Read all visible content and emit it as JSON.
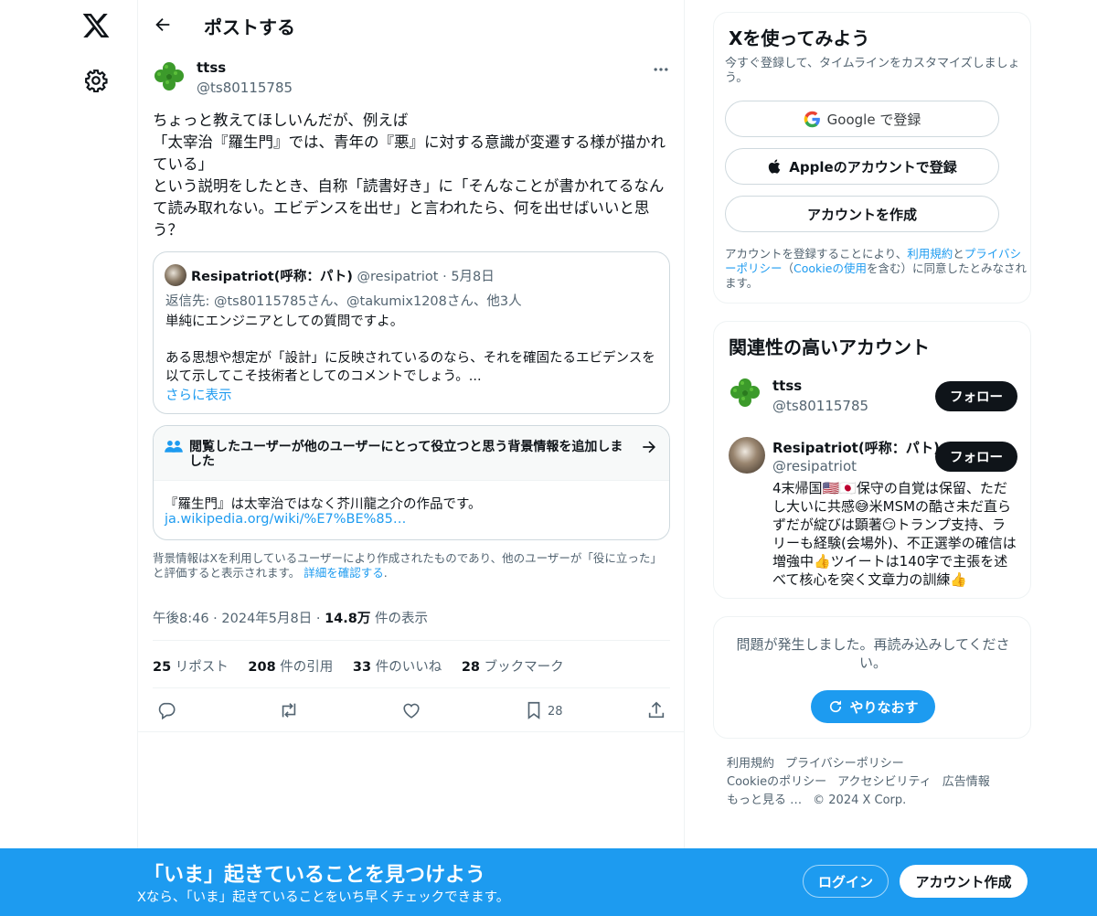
{
  "header": {
    "title": "ポストする"
  },
  "post": {
    "author_name": "ttss",
    "author_handle": "@ts80115785",
    "text": "ちょっと教えてほしいんだが、例えば\n「太宰治『羅生門』では、青年の『悪』に対する意識が変遷する様が描かれている」\nという説明をしたとき、自称「読書好き」に「そんなことが書かれてるなんて読み取れない。エビデンスを出せ」と言われたら、何を出せばいいと思う？",
    "time": "午後8:46",
    "date": "2024年5月8日",
    "views_count": "14.8万",
    "views_label": "件の表示",
    "reposts_count": "25",
    "reposts_label": "リポスト",
    "quotes_count": "208",
    "quotes_label": "件の引用",
    "likes_count": "33",
    "likes_label": "件のいいね",
    "bookmarks_count": "28",
    "bookmarks_label": "ブックマーク",
    "action_bookmark_count": "28"
  },
  "quote": {
    "author_name": "Resipatriot(呼称：パト)",
    "author_handle": "@resipatriot",
    "date": "5月8日",
    "reply_to": "返信先: @ts80115785さん、@takumix1208さん、他3人",
    "text": "単純にエンジニアとしての質問ですよ。\n\nある思想や想定が「設計」に反映されているのなら、それを確固たるエビデンスを以て示してこそ技術者としてのコメントでしょう。...",
    "show_more": "さらに表示"
  },
  "community_note": {
    "title": "閲覧したユーザーが他のユーザーにとって役立つと思う背景情報を追加しました",
    "body": "『羅生門』は太宰治ではなく芥川龍之介の作品です。",
    "link": "ja.wikipedia.org/wiki/%E7%BE%85…",
    "footer": "背景情報はXを利用しているユーザーにより作成されたものであり、他のユーザーが「役に立った」と評価すると表示されます。",
    "footer_link": "詳細を確認する"
  },
  "signup_card": {
    "title": "Xを使ってみよう",
    "subtitle": "今すぐ登録して、タイムラインをカスタマイズしましょう。",
    "google_label": "Google で登録",
    "apple_label": "Appleのアカウントで登録",
    "create_label": "アカウントを作成",
    "terms_pre": "アカウントを登録することにより、",
    "terms_link": "利用規約",
    "terms_and": "と",
    "privacy_link": "プライバシーポリシー",
    "cookie_pre": "（",
    "cookie_link": "Cookieの使用",
    "terms_post": "を含む）に同意したとみなされます。"
  },
  "relevant": {
    "title": "関連性の高いアカウント",
    "accounts": [
      {
        "name": "ttss",
        "handle": "@ts80115785",
        "follow": "フォロー"
      },
      {
        "name": "Resipatriot(呼称：パト)",
        "handle": "@resipatriot",
        "follow": "フォロー",
        "bio": "4末帰国🇺🇸🇯🇵保守の自覚は保留、ただし大いに共感😅米MSMの酷さ未だ直らずだが綻びは顕著😏トランプ支持、ラリーも経験(会場外)、不正選挙の確信は増強中👍ツイートは140字で主張を述べて核心を突く文章力の訓練👍"
      }
    ]
  },
  "error_card": {
    "text": "問題が発生しました。再読み込みしてください。",
    "retry": "やりなおす"
  },
  "footer": {
    "links": [
      "利用規約",
      "プライバシーポリシー",
      "Cookieのポリシー",
      "アクセシビリティ",
      "広告情報",
      "もっと見る …"
    ],
    "copyright": "© 2024 X Corp."
  },
  "banner": {
    "title": "「いま」起きていることを見つけよう",
    "subtitle": "Xなら、「いま」起きていることをいち早くチェックできます。",
    "login": "ログイン",
    "signup": "アカウント作成"
  },
  "colors": {
    "accent": "#1d9bf0",
    "text": "#0f1419",
    "muted": "#536471"
  },
  "icons": [
    "x-logo-icon",
    "gear-icon",
    "back-arrow-icon",
    "more-icon",
    "users-icon",
    "arrow-right-icon",
    "reply-icon",
    "repost-icon",
    "like-icon",
    "bookmark-icon",
    "share-icon",
    "google-icon",
    "apple-icon",
    "refresh-icon"
  ]
}
